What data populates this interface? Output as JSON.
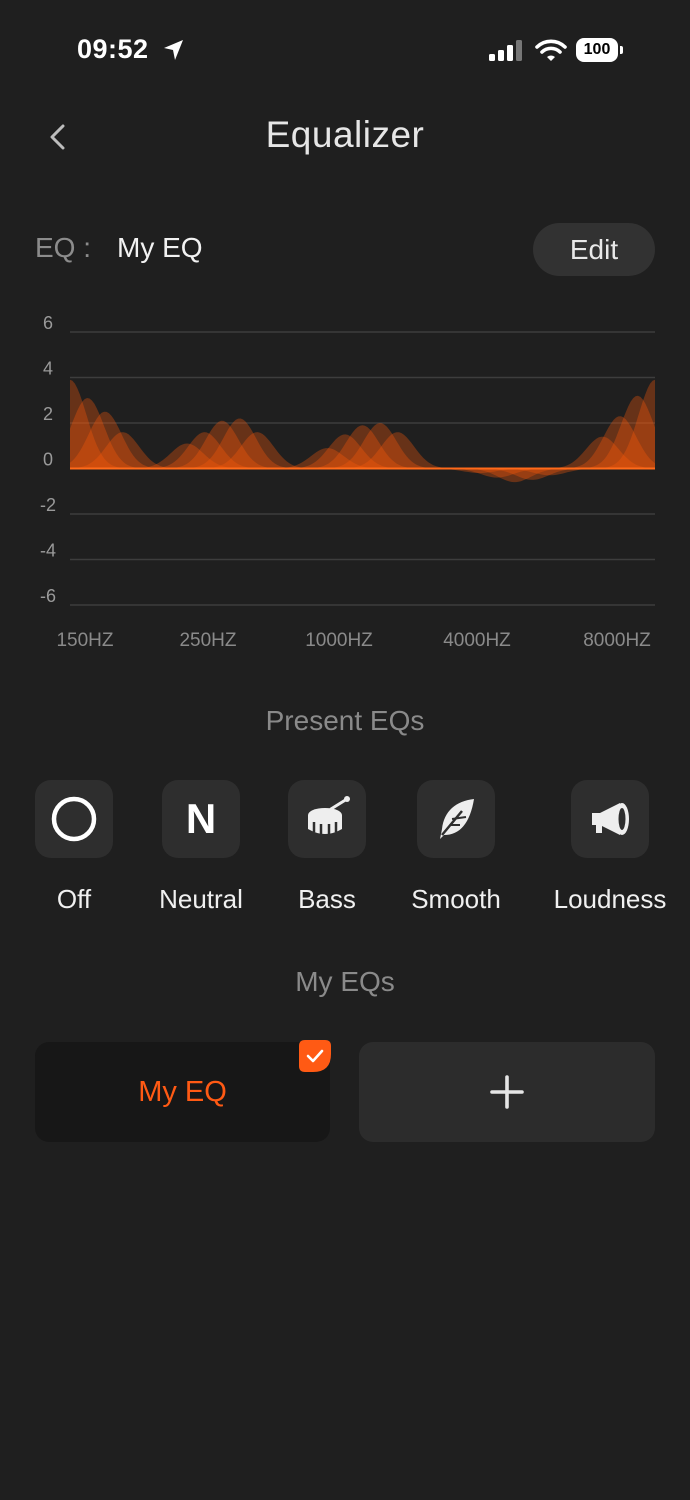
{
  "status_bar": {
    "time": "09:52",
    "battery": "100",
    "icons": [
      "location-arrow-icon",
      "cellular-signal-icon",
      "wifi-icon",
      "battery-icon"
    ]
  },
  "header": {
    "title": "Equalizer",
    "back_icon": "chevron-left-icon"
  },
  "eq_row": {
    "label": "EQ :",
    "current": "My EQ",
    "edit_label": "Edit"
  },
  "chart_data": {
    "type": "area",
    "x_labels": [
      "150HZ",
      "250HZ",
      "1000HZ",
      "4000HZ",
      "8000HZ"
    ],
    "y_ticks": [
      6,
      4,
      2,
      0,
      -2,
      -4,
      -6
    ],
    "ylim": [
      -6,
      6
    ],
    "bands": [
      {
        "center": 0.0,
        "gain": 3.9
      },
      {
        "center": 0.03,
        "gain": 3.1
      },
      {
        "center": 0.06,
        "gain": 2.5
      },
      {
        "center": 0.09,
        "gain": 1.6
      },
      {
        "center": 0.2,
        "gain": 1.1
      },
      {
        "center": 0.23,
        "gain": 1.6
      },
      {
        "center": 0.26,
        "gain": 2.1
      },
      {
        "center": 0.29,
        "gain": 2.2
      },
      {
        "center": 0.32,
        "gain": 1.6
      },
      {
        "center": 0.44,
        "gain": 0.9
      },
      {
        "center": 0.47,
        "gain": 1.5
      },
      {
        "center": 0.5,
        "gain": 1.9
      },
      {
        "center": 0.53,
        "gain": 2.0
      },
      {
        "center": 0.56,
        "gain": 1.6
      },
      {
        "center": 0.7,
        "gain": -0.2
      },
      {
        "center": 0.73,
        "gain": -0.4
      },
      {
        "center": 0.76,
        "gain": -0.6
      },
      {
        "center": 0.79,
        "gain": -0.5
      },
      {
        "center": 0.82,
        "gain": -0.3
      },
      {
        "center": 0.91,
        "gain": 1.4
      },
      {
        "center": 0.94,
        "gain": 2.3
      },
      {
        "center": 0.97,
        "gain": 3.2
      },
      {
        "center": 1.0,
        "gain": 3.9
      }
    ],
    "grid": true,
    "fill_color": "#ff5a0a",
    "baseline_color": "#ff6a1a"
  },
  "presets": {
    "title": "Present EQs",
    "items": [
      {
        "label": "Off",
        "icon": "circle-icon"
      },
      {
        "label": "Neutral",
        "icon": "N"
      },
      {
        "label": "Bass",
        "icon": "drum-icon"
      },
      {
        "label": "Smooth",
        "icon": "feather-icon"
      },
      {
        "label": "Loudness",
        "icon": "megaphone-icon"
      }
    ]
  },
  "my_eqs": {
    "title": "My EQs",
    "items": [
      {
        "label": "My EQ",
        "selected": true
      }
    ],
    "add_icon": "plus-icon"
  },
  "colors": {
    "background": "#1f1f1f",
    "accent": "#ff5a14",
    "tile": "#2e2e2e"
  }
}
